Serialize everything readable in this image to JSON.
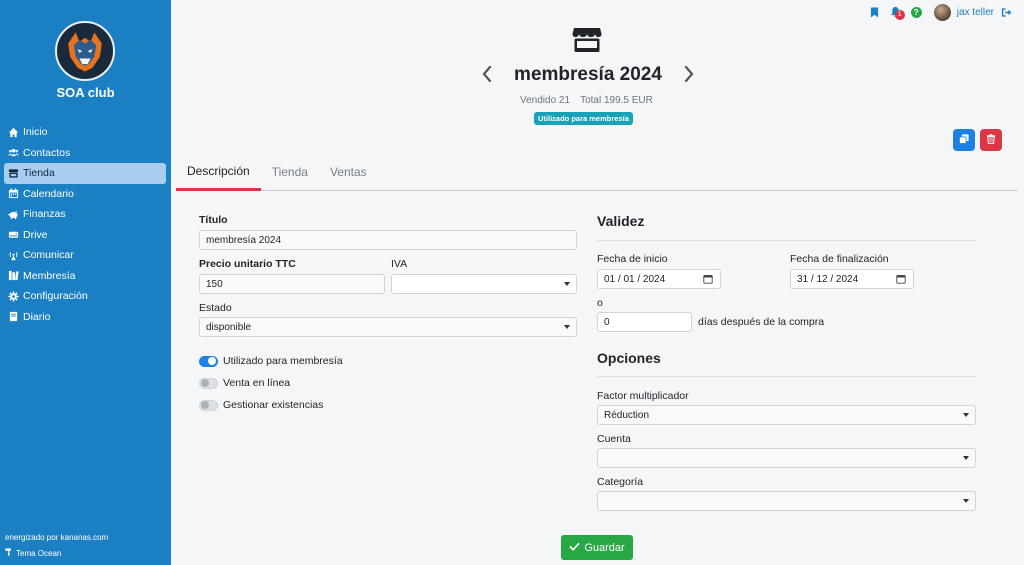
{
  "sidebar": {
    "club_name": "SOA club",
    "items": [
      {
        "label": "Inicio",
        "icon": "home-icon"
      },
      {
        "label": "Contactos",
        "icon": "users-icon"
      },
      {
        "label": "Tienda",
        "icon": "store-icon"
      },
      {
        "label": "Calendario",
        "icon": "calendar-icon"
      },
      {
        "label": "Finanzas",
        "icon": "piggy-bank-icon"
      },
      {
        "label": "Drive",
        "icon": "drive-icon"
      },
      {
        "label": "Comunicar",
        "icon": "broadcast-icon"
      },
      {
        "label": "Membresía",
        "icon": "membership-icon"
      },
      {
        "label": "Configuración",
        "icon": "gear-icon"
      },
      {
        "label": "Diario",
        "icon": "book-icon"
      }
    ],
    "active_index": 2,
    "powered_by": "energizado por kananas.com",
    "theme": "Tema Ocean"
  },
  "topbar": {
    "notification_count": "1",
    "help": "?",
    "user_name": "jax teller"
  },
  "header": {
    "title": "membresía 2024",
    "sold": "Vendido 21",
    "total": "Total 199.5 EUR",
    "badge": "Utilizado para membresía"
  },
  "tabs": [
    "Descripción",
    "Tienda",
    "Ventas"
  ],
  "form": {
    "title_label": "Título",
    "title_value": "membresía 2024",
    "price_label": "Precio unitario TTC",
    "price_value": "150",
    "vat_label": "IVA",
    "vat_value": "",
    "status_label": "Estado",
    "status_value": "disponible",
    "toggles": [
      {
        "label": "Utilizado para membresía",
        "on": true
      },
      {
        "label": "Venta en línea",
        "on": false
      },
      {
        "label": "Gestionar existencias",
        "on": false
      }
    ]
  },
  "validity": {
    "heading": "Validez",
    "start_label": "Fecha de inicio",
    "start_value": "01 / 01 / 2024",
    "end_label": "Fecha de finalización",
    "end_value": "31 / 12 / 2024",
    "or": "o",
    "days_value": "0",
    "days_suffix": "días después de la compra"
  },
  "options": {
    "heading": "Opciones",
    "factor_label": "Factor multiplicador",
    "factor_value": "Réduction",
    "account_label": "Cuenta",
    "account_value": "",
    "category_label": "Categoría",
    "category_value": ""
  },
  "save_label": "Guardar",
  "colors": {
    "sidebar": "#1b7fc4",
    "primary": "#1e80e2",
    "danger": "#dc3545",
    "success": "#28a745",
    "info": "#17a2b8"
  }
}
